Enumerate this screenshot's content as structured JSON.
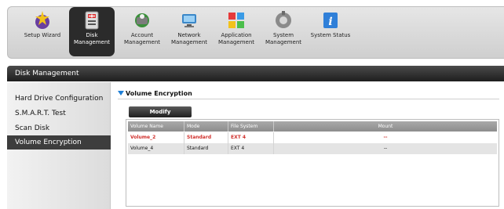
{
  "toolbar": {
    "items": [
      {
        "label": "Setup Wizard",
        "icon": "wizard-icon"
      },
      {
        "label": "Disk\nManagement",
        "icon": "disk-management-icon",
        "active": true
      },
      {
        "label": "Account\nManagement",
        "icon": "account-management-icon"
      },
      {
        "label": "Network\nManagement",
        "icon": "network-management-icon"
      },
      {
        "label": "Application\nManagement",
        "icon": "application-management-icon"
      },
      {
        "label": "System\nManagement",
        "icon": "system-management-icon"
      },
      {
        "label": "System Status",
        "icon": "system-status-icon"
      }
    ]
  },
  "titlebar": {
    "title": "Disk Management"
  },
  "sidebar": {
    "items": [
      {
        "label": "Hard Drive Configuration"
      },
      {
        "label": "S.M.A.R.T. Test"
      },
      {
        "label": "Scan Disk"
      },
      {
        "label": "Volume Encryption",
        "active": true
      }
    ]
  },
  "main": {
    "section_title": "Volume Encryption",
    "modify_label": "Modify",
    "table": {
      "headers": [
        "Volume Name",
        "Mode",
        "File System",
        "Mount"
      ],
      "rows": [
        {
          "name": "Volume_2",
          "mode": "Standard",
          "fs": "EXT 4",
          "mount": "--",
          "selected": true
        },
        {
          "name": "Volume_4",
          "mode": "Standard",
          "fs": "EXT 4",
          "mount": "--",
          "selected": false
        }
      ]
    }
  },
  "colors": {
    "accent": "#1f7fd6",
    "selected_text": "#d0312d"
  }
}
